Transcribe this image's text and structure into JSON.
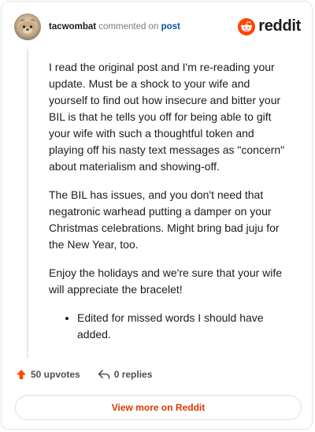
{
  "comment": {
    "username": "tacwombat",
    "action_text": "commented on",
    "post_link": "post",
    "paragraphs": [
      "I read the original post and I'm re-reading your update. Must be a shock to your wife and yourself to find out how insecure and bitter your BIL is that he tells you off for being able to gift your wife with such a thoughtful token and playing off his nasty text messages as \"concern\" about materialism and showing-off.",
      "The BIL has issues, and you don't need that negatronic warhead putting a damper on your Christmas celebrations. Might bring bad juju for the New Year, too.",
      "Enjoy the holidays and we're sure that your wife will appreciate the bracelet!"
    ],
    "bullets": [
      "Edited for missed words I should have added."
    ]
  },
  "brand": {
    "name": "reddit",
    "accent": "#ff4500"
  },
  "actions": {
    "upvotes_label": "50 upvotes",
    "replies_label": "0 replies",
    "upvote_color": "#ff4500"
  },
  "footer": {
    "view_more_label": "View more on Reddit",
    "accent": "#d93a00"
  },
  "icons": [
    "avatar",
    "reddit-logo-icon",
    "upvote-arrow-icon",
    "reply-icon"
  ]
}
